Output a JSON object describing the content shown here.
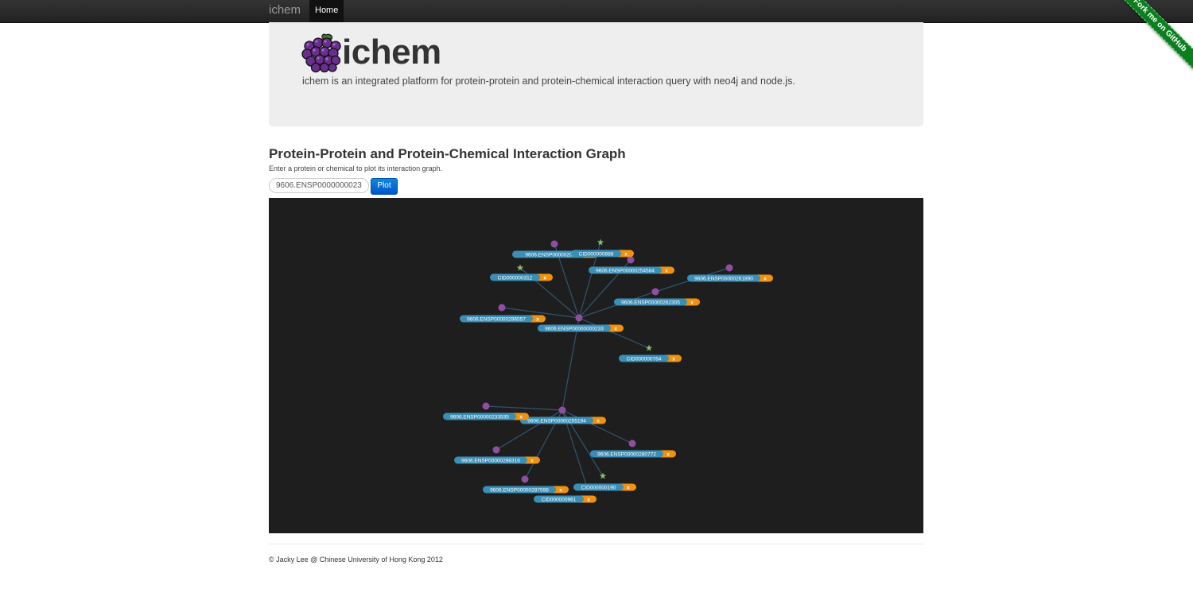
{
  "nav": {
    "brand": "ichem",
    "home": "Home"
  },
  "ribbon": {
    "text": "Fork me on GitHub"
  },
  "hero": {
    "title": "ichem",
    "description": "ichem is an integrated platform for protein-protein and protein-chemical interaction query with neo4j and node.js."
  },
  "main": {
    "title": "Protein-Protein and Protein-Chemical Interaction Graph",
    "subtitle": "Enter a protein or chemical to plot its interaction graph.",
    "search_value": "9606.ENSP0000000023",
    "plot_label": "Plot"
  },
  "graph": {
    "nodes": [
      {
        "id": "p233",
        "label": "9606.ENSP00000000233",
        "kind": "protein"
      },
      {
        "id": "p204",
        "label": "9606.ENSP0000020",
        "kind": "protein"
      },
      {
        "id": "c888",
        "label": "CID000000888",
        "kind": "chemical"
      },
      {
        "id": "p254584",
        "label": "9606.ENSP00000254584",
        "kind": "protein"
      },
      {
        "id": "c312",
        "label": "CID000000312",
        "kind": "chemical"
      },
      {
        "id": "p261890",
        "label": "9606.ENSP00000261890",
        "kind": "protein"
      },
      {
        "id": "p262305",
        "label": "9606.ENSP00000262305",
        "kind": "protein"
      },
      {
        "id": "p296557",
        "label": "9606.ENSP00000296557",
        "kind": "protein"
      },
      {
        "id": "c764",
        "label": "CID000000764",
        "kind": "chemical"
      },
      {
        "id": "p255194",
        "label": "9606.ENSP00000255194",
        "kind": "protein"
      },
      {
        "id": "p233535",
        "label": "9606.ENSP00000233535",
        "kind": "protein"
      },
      {
        "id": "p298316",
        "label": "9606.ENSP00000298316",
        "kind": "protein"
      },
      {
        "id": "p280772",
        "label": "9606.ENSP00000280772",
        "kind": "protein"
      },
      {
        "id": "p287598",
        "label": "9606.ENSP00000287598",
        "kind": "protein"
      },
      {
        "id": "c190",
        "label": "CID000000190",
        "kind": "chemical"
      },
      {
        "id": "c961",
        "label": "CID000000961",
        "kind": "chemical"
      }
    ],
    "edges": [
      [
        "p233",
        "p204"
      ],
      [
        "p233",
        "c888"
      ],
      [
        "p233",
        "p254584"
      ],
      [
        "p233",
        "c312"
      ],
      [
        "p233",
        "p262305"
      ],
      [
        "p233",
        "p296557"
      ],
      [
        "p233",
        "c764"
      ],
      [
        "p233",
        "p255194"
      ],
      [
        "p262305",
        "p261890"
      ],
      [
        "p255194",
        "p233535"
      ],
      [
        "p255194",
        "p298316"
      ],
      [
        "p255194",
        "p280772"
      ],
      [
        "p255194",
        "p287598"
      ],
      [
        "p255194",
        "c190"
      ],
      [
        "p255194",
        "c961"
      ]
    ],
    "remove_label": "x",
    "colors": {
      "background": "#1e1e1e",
      "edge": "#2f5670",
      "protein": "#8e4fa0",
      "chemical": "#7ec26a",
      "label_bg": "#3a8fb7",
      "remove_bg": "#f0920f"
    }
  },
  "footer": {
    "text": "© Jacky Lee @ Chinese University of Hong Kong 2012"
  }
}
